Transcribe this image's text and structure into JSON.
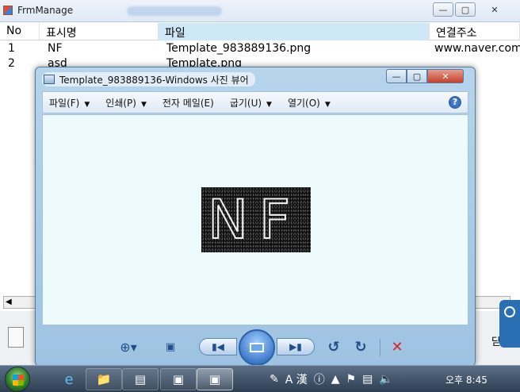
{
  "background_window": {
    "title": "FrmManage",
    "columns": [
      "No",
      "표시명",
      "파일",
      "연결주소"
    ],
    "rows": [
      {
        "no": "1",
        "name": "NF",
        "file": "Template_983889136.png",
        "url": "www.naver.com"
      },
      {
        "no": "2",
        "name": "asd",
        "file": "Template.png",
        "url": ""
      }
    ],
    "close_label": "닫기"
  },
  "viewer": {
    "title": "Template_983889136-Windows 사진 뷰어",
    "menu": [
      "파일(F)",
      "인쇄(P)",
      "전자 메일(E)",
      "굽기(U)",
      "열기(O)"
    ],
    "preview_text": "NF"
  },
  "taskbar": {
    "tray_text": "A 漢",
    "clock": "오후 8:45"
  },
  "colors": {
    "viewer_frame": "#9ec3e2",
    "viewer_canvas": "#eefbfd",
    "taskbar": "#2e3e52",
    "delete_icon": "#dd2222"
  },
  "icons": {
    "help": "help-icon",
    "zoom": "zoom-icon",
    "fit": "fit-window-icon",
    "prev": "previous-icon",
    "slideshow": "slideshow-icon",
    "next": "next-icon",
    "rotate_ccw": "rotate-counterclockwise-icon",
    "rotate_cw": "rotate-clockwise-icon",
    "delete": "delete-icon"
  }
}
